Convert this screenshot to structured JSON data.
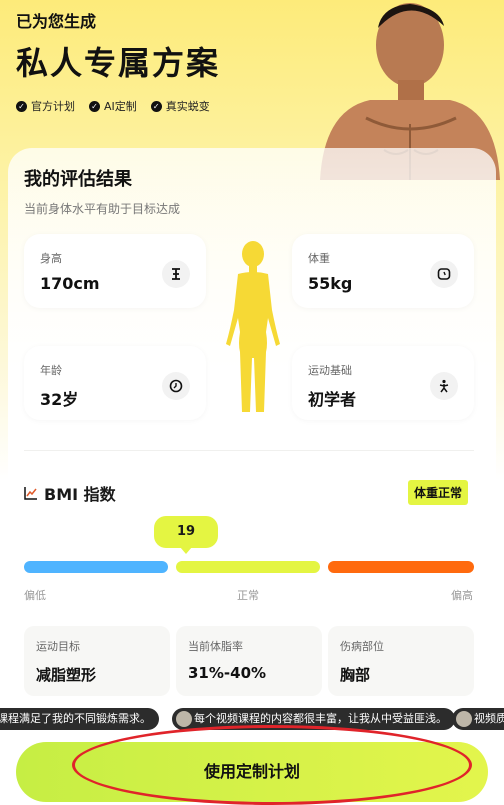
{
  "header": {
    "subtitle": "已为您生成",
    "title": "私人专属方案",
    "badges": [
      "官方计划",
      "AI定制",
      "真实蜕变"
    ]
  },
  "assessment": {
    "title": "我的评估结果",
    "subtitle": "当前身体水平有助于目标达成",
    "stats": [
      {
        "label": "身高",
        "value": "170cm",
        "icon": "height-icon"
      },
      {
        "label": "体重",
        "value": "55kg",
        "icon": "scale-icon"
      },
      {
        "label": "年龄",
        "value": "32岁",
        "icon": "clock-icon"
      },
      {
        "label": "运动基础",
        "value": "初学者",
        "icon": "exercise-icon"
      }
    ]
  },
  "bmi": {
    "title": "BMI 指数",
    "status": "体重正常",
    "value": "19",
    "ranges": [
      "偏低",
      "正常",
      "偏高"
    ],
    "colors": {
      "low": "#4fb4ff",
      "normal": "#e4f542",
      "high": "#ff6a0e"
    }
  },
  "goals": [
    {
      "label": "运动目标",
      "value": "减脂塑形"
    },
    {
      "label": "当前体脂率",
      "value": "31%-40%"
    },
    {
      "label": "伤病部位",
      "value": "胸部"
    }
  ],
  "ticker": [
    "洋课程满足了我的不同锻炼需求。",
    "每个视频课程的内容都很丰富，让我从中受益匪浅。",
    "视频质"
  ],
  "cta": {
    "label": "使用定制计划"
  },
  "colors": {
    "accent": "#e4f542",
    "annotation": "#e0242a"
  }
}
